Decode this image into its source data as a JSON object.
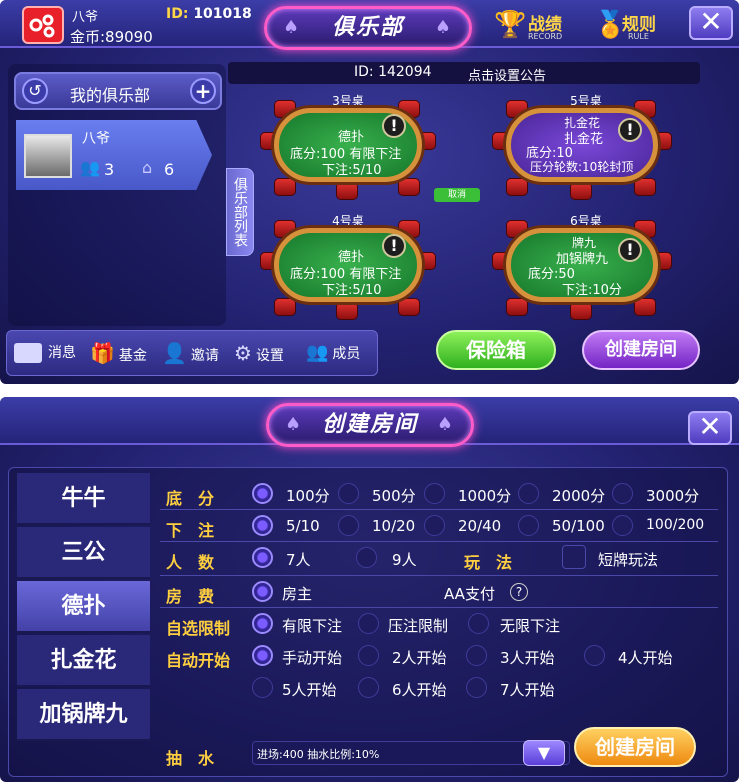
{
  "club": {
    "player_name": "八爷",
    "id_label": "ID:",
    "id_value": "101018",
    "gold": "金币:89090",
    "title": "俱乐部",
    "record_label": "战绩",
    "record_sub": "RECORD",
    "rule_label": "规则",
    "rule_sub": "RULE",
    "close": "✕",
    "club_id": "ID: 142094",
    "notice": "点击设置公告",
    "my_club": "我的俱乐部",
    "club_name": "八爷",
    "members_count": "3",
    "rooms_count": "6",
    "list_tab": "俱乐部列表",
    "tables": [
      {
        "label": "3号桌",
        "game": "德扑",
        "line1": "底分:100   有限下注",
        "line2": "下注:5/10"
      },
      {
        "label": "5号桌",
        "game": "扎金花",
        "line0": "扎金花",
        "line1": "底分:10",
        "line2": "压分轮数:10轮封顶"
      },
      {
        "label": "4号桌",
        "game": "德扑",
        "line1": "底分:100   有限下注",
        "line2": "下注:5/10"
      },
      {
        "label": "6号桌",
        "game": "牌九",
        "line0": "加锅牌九",
        "line1": "底分:50",
        "line2": "下注:10分"
      }
    ],
    "small_tag": "取消",
    "footer": {
      "messages": "消息",
      "fund": "基金",
      "invite": "邀请",
      "settings": "设置",
      "members": "成员"
    },
    "safe_button": "保险箱",
    "create_button": "创建房间"
  },
  "create": {
    "title": "创建房间",
    "close": "✕",
    "games": [
      "牛牛",
      "三公",
      "德扑",
      "扎金花",
      "加锅牌九"
    ],
    "selected_game": "德扑",
    "rows": {
      "base_label": "底　分",
      "base_options": [
        "100分",
        "500分",
        "1000分",
        "2000分",
        "3000分"
      ],
      "bet_label": "下　注",
      "bet_options": [
        "5/10",
        "10/20",
        "20/40",
        "50/100",
        "100/200"
      ],
      "players_label": "人　数",
      "players_options": [
        "7人",
        "9人"
      ],
      "play_label": "玩　法",
      "play_option": "短牌玩法",
      "fee_label": "房　费",
      "fee_options": [
        "房主",
        "AA支付"
      ],
      "help": "?",
      "limit_label": "自选限制",
      "limit_options": [
        "有限下注",
        "压注限制",
        "无限下注"
      ],
      "auto_label": "自动开始",
      "auto_options": [
        "手动开始",
        "2人开始",
        "3人开始",
        "4人开始",
        "5人开始",
        "6人开始",
        "7人开始"
      ],
      "rake_label": "抽　水",
      "rake_value": "进场:400 抽水比例:10%"
    },
    "create_button": "创建房间"
  }
}
